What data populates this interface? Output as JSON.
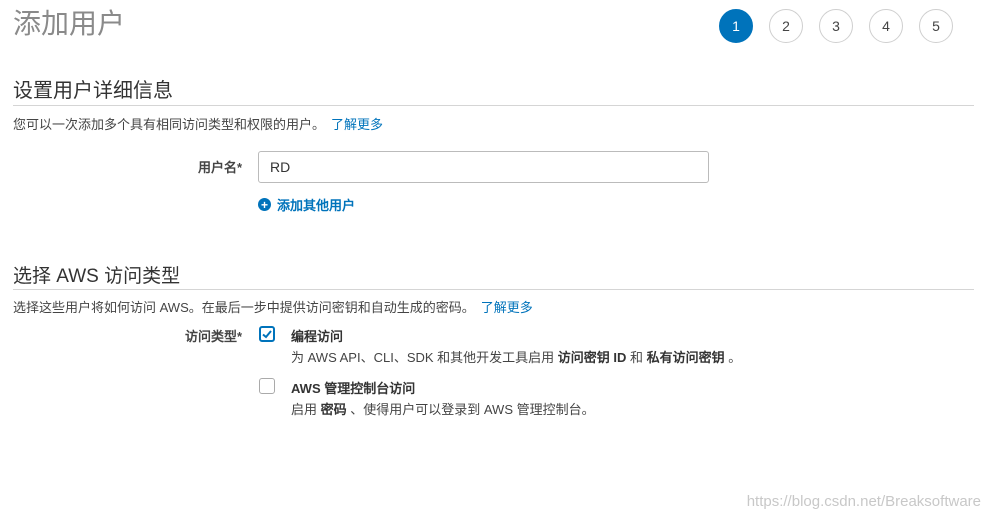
{
  "page": {
    "title": "添加用户"
  },
  "steps": [
    "1",
    "2",
    "3",
    "4",
    "5"
  ],
  "active_step": 1,
  "details": {
    "title": "设置用户详细信息",
    "description": "您可以一次添加多个具有相同访问类型和权限的用户。",
    "learn_more": "了解更多",
    "username_label": "用户名*",
    "username_value": "RD",
    "add_other_user": "添加其他用户"
  },
  "access": {
    "title": "选择 AWS 访问类型",
    "description": "选择这些用户将如何访问 AWS。在最后一步中提供访问密钥和自动生成的密码。",
    "learn_more": "了解更多",
    "type_label": "访问类型*",
    "options": [
      {
        "title": "编程访问",
        "checked": true,
        "desc_pre": "为 AWS API、CLI、SDK 和其他开发工具启用 ",
        "desc_bold1": "访问密钥 ID",
        "desc_mid": " 和 ",
        "desc_bold2": "私有访问密钥",
        "desc_post": " 。"
      },
      {
        "title": "AWS 管理控制台访问",
        "checked": false,
        "desc_pre": "启用 ",
        "desc_bold1": "密码",
        "desc_post": " 、使得用户可以登录到 AWS 管理控制台。"
      }
    ]
  },
  "watermark": "https://blog.csdn.net/Breaksoftware",
  "colors": {
    "accent": "#0073bb",
    "rule": "#d5d5d5",
    "title_gray": "#8a8a8a"
  }
}
